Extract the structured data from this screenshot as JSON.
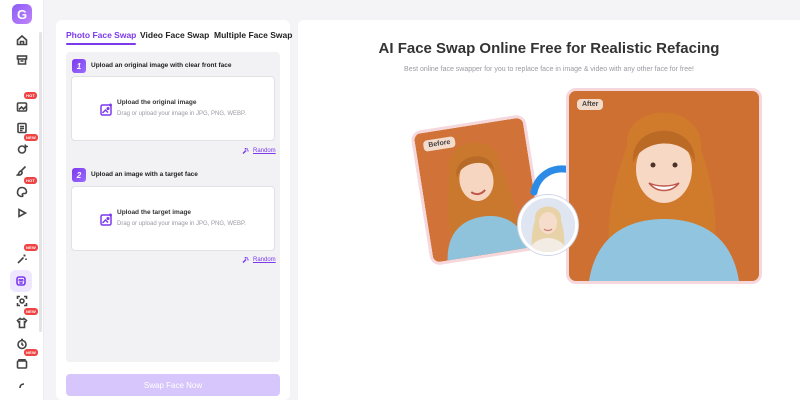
{
  "app": {
    "logo_letter": "G"
  },
  "sidebar": {
    "items": [
      {
        "icon": "home-icon",
        "badge": ""
      },
      {
        "icon": "archive-icon",
        "badge": ""
      },
      {
        "icon": "image-edit-icon",
        "badge": "HOT"
      },
      {
        "icon": "document-icon",
        "badge": ""
      },
      {
        "icon": "sparkle-face-icon",
        "badge": "NEW"
      },
      {
        "icon": "brush-icon",
        "badge": ""
      },
      {
        "icon": "palette-icon",
        "badge": "HOT"
      },
      {
        "icon": "video-icon",
        "badge": ""
      },
      {
        "icon": "magic-icon",
        "badge": "NEW"
      },
      {
        "icon": "face-swap-icon",
        "badge": ""
      },
      {
        "icon": "scan-icon",
        "badge": ""
      },
      {
        "icon": "shirt-icon",
        "badge": "NEW"
      },
      {
        "icon": "timer-icon",
        "badge": ""
      },
      {
        "icon": "gallery-icon",
        "badge": "NEW"
      },
      {
        "icon": "more-icon",
        "badge": ""
      }
    ]
  },
  "tabs": [
    {
      "label": "Photo Face Swap",
      "active": true
    },
    {
      "label": "Video Face Swap",
      "active": false
    },
    {
      "label": "Multiple Face Swap",
      "active": false
    }
  ],
  "steps": [
    {
      "number": "1",
      "text": "Upload an original image with clear front face",
      "upload_title": "Upload the original image",
      "upload_sub": "Drag or upload your image in JPG, PNG, WEBP.",
      "random_label": "Random"
    },
    {
      "number": "2",
      "text": "Upload an image with a target face",
      "upload_title": "Upload the target image",
      "upload_sub": "Drag or upload your image in JPG, PNG, WEBP.",
      "random_label": "Random"
    }
  ],
  "action": {
    "swap_label": "Swap Face Now"
  },
  "hero": {
    "title": "AI Face Swap Online Free for Realistic Refacing",
    "subtitle": "Best online face swapper for you to replace face in image & video with any other face for free!",
    "before_label": "Before",
    "after_label": "After"
  },
  "colors": {
    "accent": "#7c3aed",
    "button_disabled": "#d7c6fb",
    "badge": "#ef4444"
  }
}
